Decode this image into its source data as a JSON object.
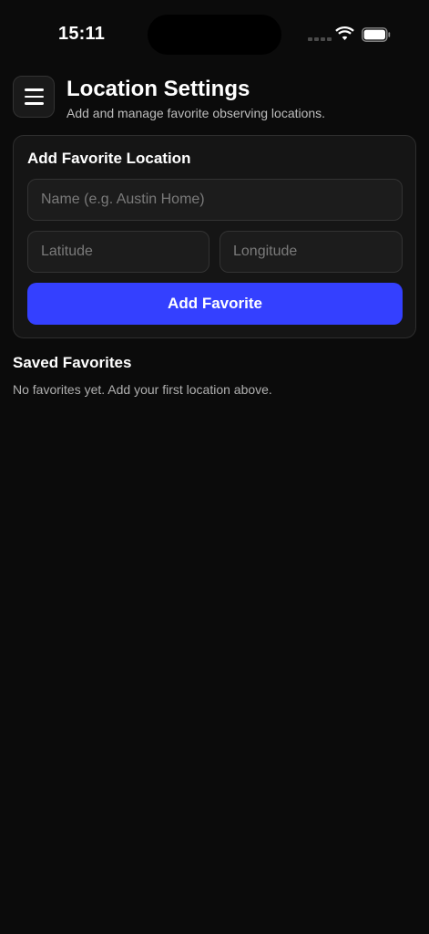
{
  "status_bar": {
    "time": "15:11"
  },
  "header": {
    "menu_icon": "hamburger-menu-icon",
    "title": "Location Settings",
    "subtitle": "Add and manage favorite observing locations."
  },
  "add_favorite": {
    "title": "Add Favorite Location",
    "name_placeholder": "Name (e.g. Austin Home)",
    "name_value": "",
    "latitude_placeholder": "Latitude",
    "latitude_value": "",
    "longitude_placeholder": "Longitude",
    "longitude_value": "",
    "button_label": "Add Favorite",
    "button_color": "#3440ff"
  },
  "saved_favorites": {
    "title": "Saved Favorites",
    "empty_message": "No favorites yet. Add your first location above.",
    "items": []
  },
  "theme": {
    "background": "#0b0b0b",
    "card_background": "#151515",
    "accent": "#3440ff"
  }
}
